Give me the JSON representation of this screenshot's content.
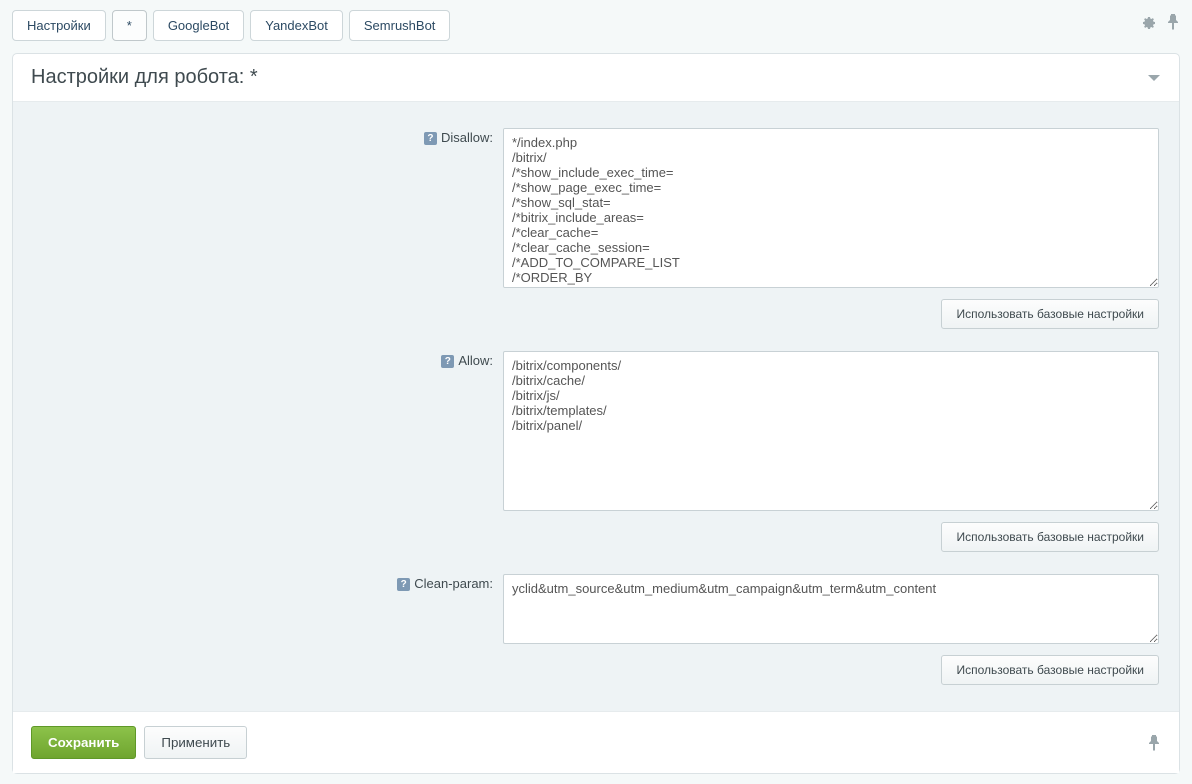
{
  "tabs": [
    "Настройки",
    "*",
    "GoogleBot",
    "YandexBot",
    "SemrushBot"
  ],
  "activeTab": 1,
  "panel": {
    "title": "Настройки для робота: *"
  },
  "fields": {
    "disallow": {
      "label": "Disallow:",
      "value": "*/index.php\n/bitrix/\n/*show_include_exec_time=\n/*show_page_exec_time=\n/*show_sql_stat=\n/*bitrix_include_areas=\n/*clear_cache=\n/*clear_cache_session=\n/*ADD_TO_COMPARE_LIST\n/*ORDER_BY\n/*PAGEN_"
    },
    "allow": {
      "label": "Allow:",
      "value": "/bitrix/components/\n/bitrix/cache/\n/bitrix/js/\n/bitrix/templates/\n/bitrix/panel/"
    },
    "cleanParam": {
      "label": "Clean-param:",
      "value": "yclid&utm_source&utm_medium&utm_campaign&utm_term&utm_content"
    }
  },
  "buttons": {
    "useBase": "Использовать базовые настройки",
    "save": "Сохранить",
    "apply": "Применить"
  }
}
